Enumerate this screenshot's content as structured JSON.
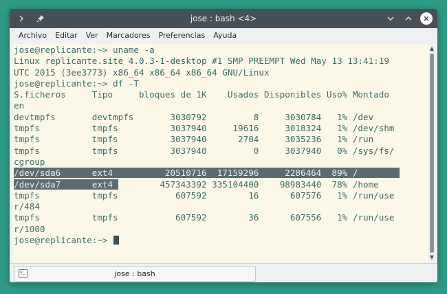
{
  "window": {
    "title": "jose : bash <4>"
  },
  "titlebar": {
    "left_icons": [
      "chevron-right-icon",
      "pin-icon"
    ],
    "right_icons": [
      "chevron-down-icon",
      "chevron-up-icon",
      "close-icon"
    ]
  },
  "menubar": {
    "items": [
      "Archivo",
      "Editar",
      "Ver",
      "Marcadores",
      "Preferencias",
      "Ayuda"
    ]
  },
  "terminal": {
    "lines": [
      "jose@replicante:~> uname -a",
      "Linux replicante.site 4.0.3-1-desktop #1 SMP PREEMPT Wed May 13 13:41:19",
      "UTC 2015 (3ee3773) x86_64 x86_64 x86_64 GNU/Linux",
      "jose@replicante:~> df -T",
      "S.ficheros     Tipo     bloques de 1K    Usados Disponibles Uso% Montado",
      "en",
      "devtmpfs       devtmpfs       3030792         8     3030784   1% /dev",
      "tmpfs          tmpfs          3037940     19616     3018324   1% /dev/shm",
      "tmpfs          tmpfs          3037940      2704     3035236   1% /run",
      "tmpfs          tmpfs          3037940         0     3037940   0% /sys/fs/",
      "cgroup",
      "/dev/sda6      ext4          20510716  17159296     2286464  89% /",
      "/dev/sda7      ext4         457343392 335104400    98983440  78% /home",
      "tmpfs          tmpfs           607592        16      607576   1% /run/use",
      "r/484",
      "tmpfs          tmpfs           607592        36      607556   1% /run/use",
      "r/1000",
      "jose@replicante:~> "
    ],
    "selected_line_full": 11,
    "selected_line_partial": 12,
    "partial_selection_chars": 20,
    "colors": {
      "background": "#fcf8e8",
      "foreground": "#3d6b6b",
      "selection": "#5c6b70"
    }
  },
  "tabbar": {
    "tab_label": "jose : bash"
  }
}
